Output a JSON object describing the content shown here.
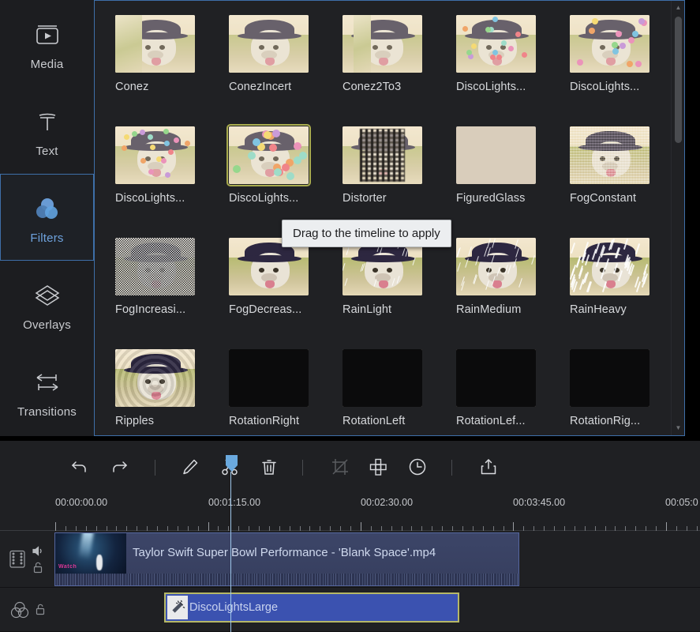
{
  "sidebar": {
    "items": [
      {
        "label": "Media",
        "icon": "media-icon",
        "active": false
      },
      {
        "label": "Text",
        "icon": "text-icon",
        "active": false
      },
      {
        "label": "Filters",
        "icon": "filters-icon",
        "active": true
      },
      {
        "label": "Overlays",
        "icon": "overlays-icon",
        "active": false
      },
      {
        "label": "Transitions",
        "icon": "transitions-icon",
        "active": false
      }
    ]
  },
  "panel": {
    "selected_filter": "DiscoLights...",
    "accent_border": "#3e6fa8",
    "selection_border": "#a9ac4e",
    "filters": [
      {
        "name": "Conez",
        "style": "conez"
      },
      {
        "name": "ConezIncert",
        "style": "conezincert"
      },
      {
        "name": "Conez2To3",
        "style": "conez2to3"
      },
      {
        "name": "DiscoLights...",
        "style": "disco-small"
      },
      {
        "name": "DiscoLights...",
        "style": "disco-mid"
      },
      {
        "name": "DiscoLights...",
        "style": "disco-big"
      },
      {
        "name": "DiscoLights...",
        "style": "disco-large",
        "selected": true
      },
      {
        "name": "Distorter",
        "style": "distorter"
      },
      {
        "name": "FiguredGlass",
        "style": "figuredglass"
      },
      {
        "name": "FogConstant",
        "style": "fogconstant"
      },
      {
        "name": "FogIncreasi...",
        "style": "fogincreasing"
      },
      {
        "name": "FogDecreas...",
        "style": "fogdecreasing"
      },
      {
        "name": "RainLight",
        "style": "rainlight"
      },
      {
        "name": "RainMedium",
        "style": "rainmedium"
      },
      {
        "name": "RainHeavy",
        "style": "rainheavy"
      },
      {
        "name": "Ripples",
        "style": "ripples"
      },
      {
        "name": "RotationRight",
        "style": "rotright"
      },
      {
        "name": "RotationLeft",
        "style": "rotleft"
      },
      {
        "name": "RotationLef...",
        "style": "rotleft2"
      },
      {
        "name": "RotationRig...",
        "style": "rotright2"
      }
    ]
  },
  "tooltip": {
    "text": "Drag to the timeline to apply"
  },
  "scrollbar": {
    "up_arrow": "▲",
    "down_arrow": "▼"
  },
  "toolbar": {
    "buttons": [
      {
        "name": "undo-button",
        "label": "Undo",
        "enabled": true
      },
      {
        "name": "redo-button",
        "label": "Redo",
        "enabled": true
      },
      {
        "name": "edit-button",
        "label": "Edit",
        "enabled": true
      },
      {
        "name": "split-button",
        "label": "Split",
        "enabled": true
      },
      {
        "name": "delete-button",
        "label": "Delete",
        "enabled": true
      },
      {
        "name": "crop-button",
        "label": "Crop",
        "enabled": false
      },
      {
        "name": "mosaic-button",
        "label": "Mosaic",
        "enabled": true
      },
      {
        "name": "speed-button",
        "label": "Speed",
        "enabled": true
      },
      {
        "name": "export-button",
        "label": "Export",
        "enabled": true
      }
    ]
  },
  "timeline": {
    "ruler_labels": [
      "00:00:00.00",
      "00:01:15.00",
      "00:02:30.00",
      "00:03:45.00",
      "00:05:0"
    ],
    "playhead_time": "00:01:15.00",
    "tracks": [
      {
        "type": "video",
        "icons": [
          "film-strip-icon",
          "volume-icon",
          "unlock-icon"
        ],
        "clip": {
          "title": "Taylor Swift Super Bowl Performance - 'Blank Space'.mp4",
          "watermark": "Watch"
        }
      },
      {
        "type": "effect",
        "icons": [
          "filter-circles-icon",
          "unlock-icon"
        ],
        "clip": {
          "title": "DiscoLightsLarge",
          "icon": "magic-wand-icon",
          "selected": true
        }
      }
    ]
  }
}
